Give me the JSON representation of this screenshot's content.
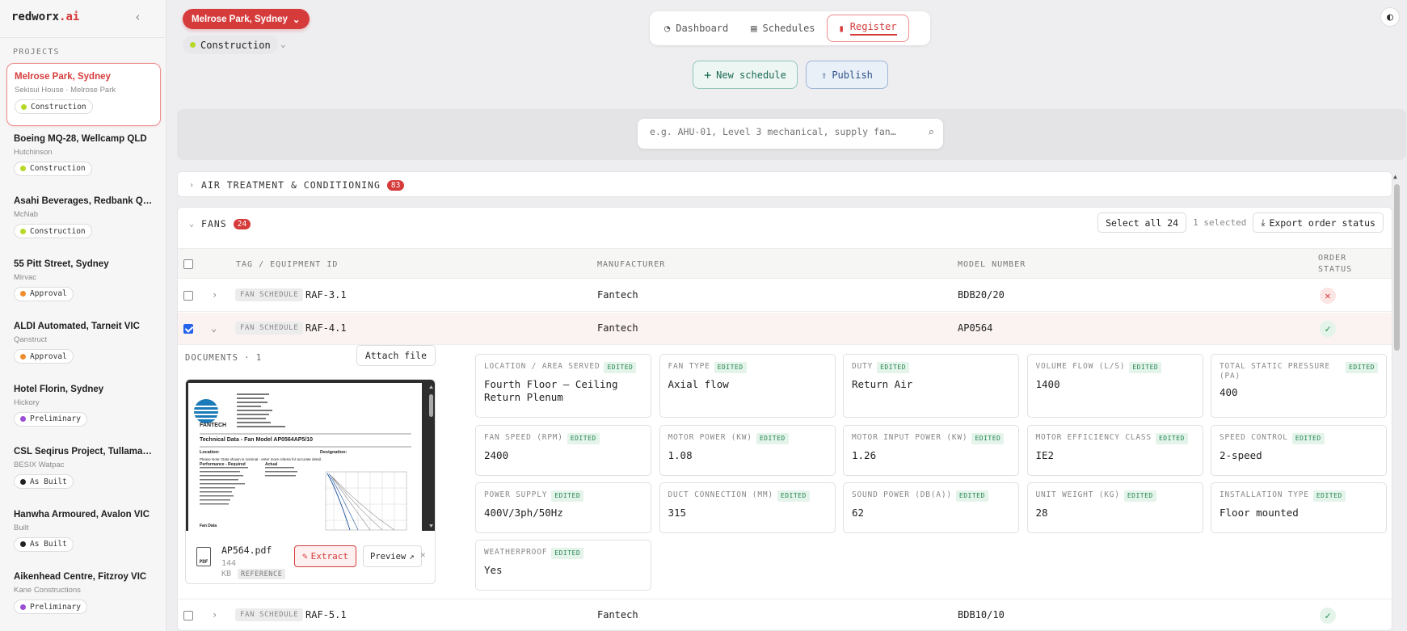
{
  "app": {
    "logo_main": "redworx",
    "logo_suffix": ".ai"
  },
  "sidebar": {
    "section_label": "PROJECTS",
    "projects": [
      {
        "name": "Melrose Park, Sydney",
        "client": "Sekisui House · Melrose Park",
        "stage": "Construction",
        "stage_color": "#b6d928",
        "active": true
      },
      {
        "name": "Boeing MQ-28, Wellcamp QLD",
        "client": "Hutchinson",
        "stage": "Construction",
        "stage_color": "#b6d928"
      },
      {
        "name": "Asahi Beverages, Redbank QLD",
        "client": "McNab",
        "stage": "Construction",
        "stage_color": "#b6d928"
      },
      {
        "name": "55 Pitt Street, Sydney",
        "client": "Mirvac",
        "stage": "Approval",
        "stage_color": "#f08c2e"
      },
      {
        "name": "ALDI Automated, Tarneit VIC",
        "client": "Qanstruct",
        "stage": "Approval",
        "stage_color": "#f08c2e"
      },
      {
        "name": "Hotel Florin, Sydney",
        "client": "Hickory",
        "stage": "Preliminary",
        "stage_color": "#9b4fd6"
      },
      {
        "name": "CSL Seqirus Project, Tullamarine VIC",
        "client": "BESIX Watpac",
        "stage": "As Built",
        "stage_color": "#222222"
      },
      {
        "name": "Hanwha Armoured, Avalon VIC",
        "client": "Built",
        "stage": "As Built",
        "stage_color": "#222222"
      },
      {
        "name": "Aikenhead Centre, Fitzroy VIC",
        "client": "Kane Constructions",
        "stage": "Preliminary",
        "stage_color": "#9b4fd6"
      }
    ]
  },
  "header": {
    "location": "Melrose Park, Sydney",
    "stage": "Construction",
    "tabs": [
      "Dashboard",
      "Schedules",
      "Register"
    ],
    "new_schedule": "New schedule",
    "publish": "Publish",
    "search_placeholder": "e.g. AHU-01, Level 3 mechanical, supply fan…"
  },
  "sections": {
    "air": {
      "title": "AIR TREATMENT & CONDITIONING",
      "count": "83"
    },
    "fans": {
      "title": "FANS",
      "count": "24",
      "select_all": "Select all 24",
      "selected": "1 selected",
      "export": "Export order status"
    }
  },
  "table": {
    "headers": {
      "tag": "TAG / EQUIPMENT ID",
      "manufacturer": "MANUFACTURER",
      "model": "MODEL NUMBER",
      "status": "ORDER STATUS"
    },
    "rows": [
      {
        "chip": "FAN SCHEDULE",
        "tag": "RAF-3.1",
        "manufacturer": "Fantech",
        "model": "BDB20/20",
        "status": "✕"
      },
      {
        "chip": "FAN SCHEDULE",
        "tag": "RAF-4.1",
        "manufacturer": "Fantech",
        "model": "AP0564",
        "status": "✓"
      },
      {
        "chip": "FAN SCHEDULE",
        "tag": "RAF-5.1",
        "manufacturer": "Fantech",
        "model": "BDB10/10",
        "status": "✓"
      }
    ]
  },
  "documents": {
    "label": "DOCUMENTS · 1",
    "attach": "Attach file",
    "file_name": "AP564.pdf",
    "file_size_num": "144",
    "file_size_unit": "KB",
    "file_tag": "REFERENCE",
    "extract": "Extract",
    "preview": "Preview",
    "pdf": {
      "brand": "FANTECH",
      "title": "Technical Data - Fan Model AP0564AP5/10",
      "location": "Location:",
      "designation": "Designation:",
      "note": "Please Note: Data shown is nominal - enter more criteria for accurate detail.",
      "perf": "Performance - Required",
      "actual": "Actual",
      "fan_data": "Fan Data"
    }
  },
  "fields": [
    {
      "label": "LOCATION / AREA SERVED",
      "value": "Fourth Floor – Ceiling Return Plenum"
    },
    {
      "label": "FAN TYPE",
      "value": "Axial flow"
    },
    {
      "label": "DUTY",
      "value": "Return Air"
    },
    {
      "label": "VOLUME FLOW (L/S)",
      "value": "1400"
    },
    {
      "label": "TOTAL STATIC PRESSURE (PA)",
      "value": "400"
    },
    {
      "label": "FAN SPEED (RPM)",
      "value": "2400"
    },
    {
      "label": "MOTOR POWER (KW)",
      "value": "1.08"
    },
    {
      "label": "MOTOR INPUT POWER (KW)",
      "value": "1.26"
    },
    {
      "label": "MOTOR EFFICIENCY CLASS",
      "value": "IE2"
    },
    {
      "label": "SPEED CONTROL",
      "value": "2-speed"
    },
    {
      "label": "POWER SUPPLY",
      "value": "400V/3ph/50Hz"
    },
    {
      "label": "DUCT CONNECTION (MM)",
      "value": "315"
    },
    {
      "label": "SOUND POWER (DB(A))",
      "value": "62"
    },
    {
      "label": "UNIT WEIGHT (KG)",
      "value": "28"
    },
    {
      "label": "INSTALLATION TYPE",
      "value": "Floor mounted"
    },
    {
      "label": "WEATHERPROOF",
      "value": "Yes"
    }
  ],
  "edited_label": "EDITED"
}
